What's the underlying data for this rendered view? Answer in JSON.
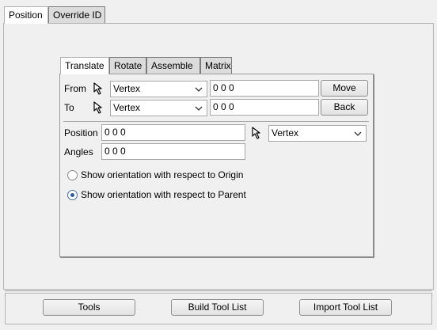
{
  "outer_tabs": [
    "Position",
    "Override ID"
  ],
  "inner_tabs": [
    "Translate",
    "Rotate",
    "Assemble",
    "Matrix"
  ],
  "from": {
    "label": "From",
    "mode": "Vertex",
    "value": "0 0 0",
    "button": "Move"
  },
  "to": {
    "label": "To",
    "mode": "Vertex",
    "value": "0 0 0",
    "button": "Back"
  },
  "position": {
    "label": "Position",
    "value": "0 0 0",
    "mode": "Vertex"
  },
  "angles": {
    "label": "Angles",
    "value": "0 0 0"
  },
  "orientation": {
    "origin_label": "Show orientation with respect to Origin",
    "parent_label": "Show orientation with respect to Parent",
    "selected": "parent"
  },
  "footer": {
    "tools": "Tools",
    "build": "Build Tool List",
    "import": "Import Tool List"
  }
}
